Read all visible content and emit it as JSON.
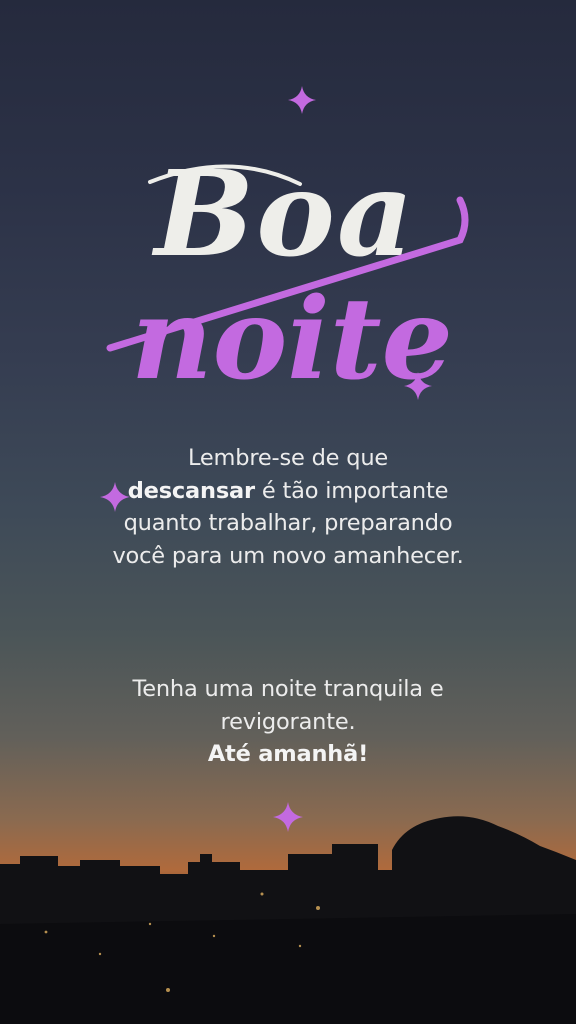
{
  "title": {
    "line1": "Boa",
    "line2": "noite"
  },
  "message": {
    "part1": "Lembre-se de que",
    "emphasis": "descansar",
    "part2": "é tão importante quanto trabalhar, preparando você para um novo amanhecer."
  },
  "closing": {
    "line1": "Tenha uma noite tranquila e revigorante.",
    "line2": "Até amanhã!"
  },
  "colors": {
    "accent": "#c36ae0",
    "title_white": "#eeeeea",
    "text": "#ececec"
  },
  "icons": [
    "sparkle-icon"
  ]
}
